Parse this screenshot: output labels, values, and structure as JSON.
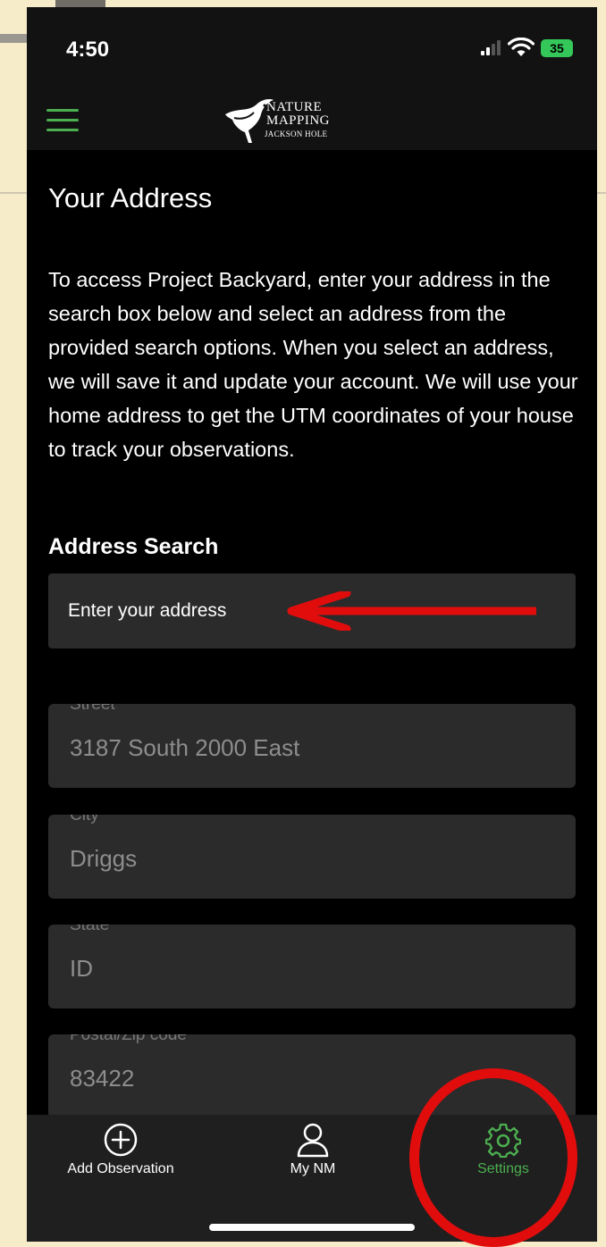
{
  "status_bar": {
    "time": "4:50",
    "battery": "35"
  },
  "header": {
    "logo_text": [
      "NATURE",
      "MAPPING",
      "JACKSON HOLE"
    ]
  },
  "page": {
    "title": "Your Address",
    "intro": "To access Project Backyard, enter your address in the search box below and select an address from the provided search options. When you select an address, we will save it and update your account. We will use your home address to get the UTM coordinates of your house to track your observations."
  },
  "address_search": {
    "label": "Address Search",
    "placeholder": "Enter your address"
  },
  "fields": [
    {
      "label": "Street",
      "value": "3187 South 2000 East"
    },
    {
      "label": "City",
      "value": "Driggs"
    },
    {
      "label": "State",
      "value": "ID"
    },
    {
      "label": "Postal/Zip code",
      "value": "83422"
    }
  ],
  "tabs": [
    {
      "label": "Add Observation",
      "icon": "plus-circle-icon"
    },
    {
      "label": "My NM",
      "icon": "person-icon"
    },
    {
      "label": "Settings",
      "icon": "gear-icon",
      "active": true
    }
  ],
  "colors": {
    "accent": "#4caf50",
    "annotation": "#e10d0d",
    "battery": "#34c759"
  }
}
